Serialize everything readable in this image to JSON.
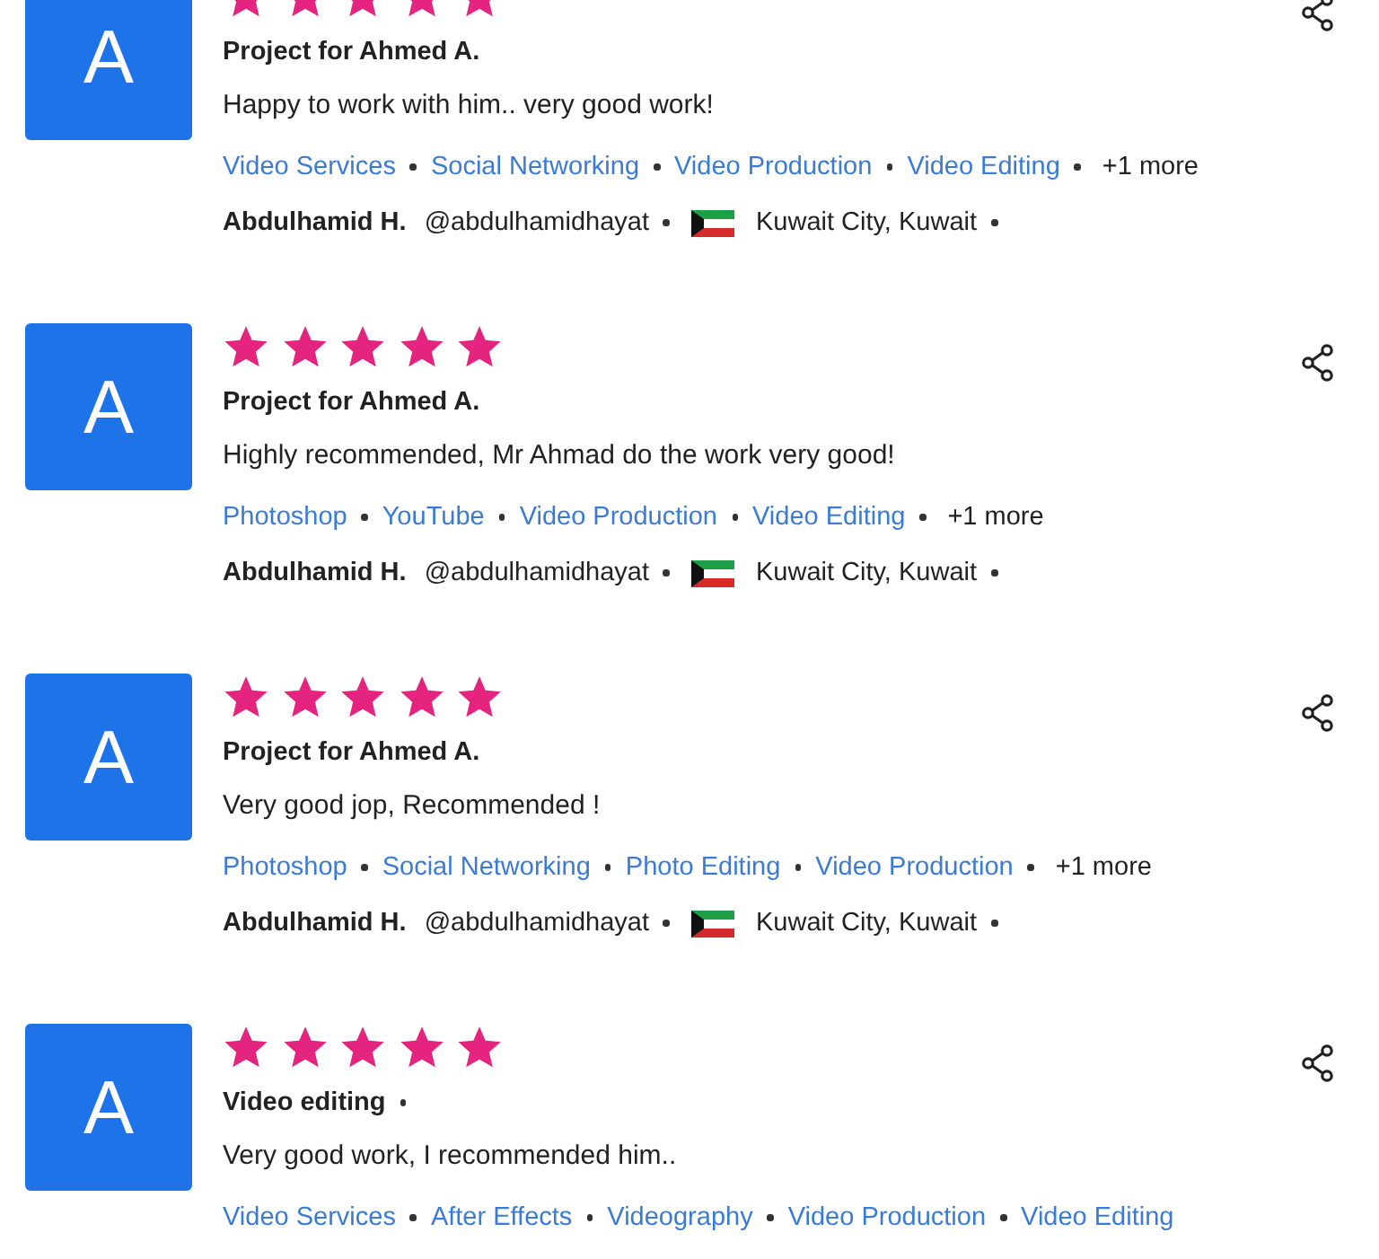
{
  "reviews": [
    {
      "avatar": "A",
      "stars": 5,
      "title": "Project for Ahmed A.",
      "title_dot": false,
      "comment": "Happy to work with him.. very good work!",
      "tags": [
        "Video Services",
        "Social Networking",
        "Video Production",
        "Video Editing"
      ],
      "more": "+1 more",
      "author": {
        "name": "Abdulhamid H.",
        "handle": "@abdulhamidhayat",
        "location": "Kuwait City, Kuwait"
      }
    },
    {
      "avatar": "A",
      "stars": 5,
      "title": "Project for Ahmed A.",
      "title_dot": false,
      "comment": "Highly recommended, Mr Ahmad do the work very good!",
      "tags": [
        "Photoshop",
        "YouTube",
        "Video Production",
        "Video Editing"
      ],
      "more": "+1 more",
      "author": {
        "name": "Abdulhamid H.",
        "handle": "@abdulhamidhayat",
        "location": "Kuwait City, Kuwait"
      }
    },
    {
      "avatar": "A",
      "stars": 5,
      "title": "Project for Ahmed A.",
      "title_dot": false,
      "comment": "Very good jop, Recommended !",
      "tags": [
        "Photoshop",
        "Social Networking",
        "Photo Editing",
        "Video Production"
      ],
      "more": "+1 more",
      "author": {
        "name": "Abdulhamid H.",
        "handle": "@abdulhamidhayat",
        "location": "Kuwait City, Kuwait"
      }
    },
    {
      "avatar": "A",
      "stars": 5,
      "title": "Video editing",
      "title_dot": true,
      "comment": "Very good work, I recommended him..",
      "tags": [
        "Video Services",
        "After Effects",
        "Videography",
        "Video Production",
        "Video Editing"
      ]
    }
  ]
}
